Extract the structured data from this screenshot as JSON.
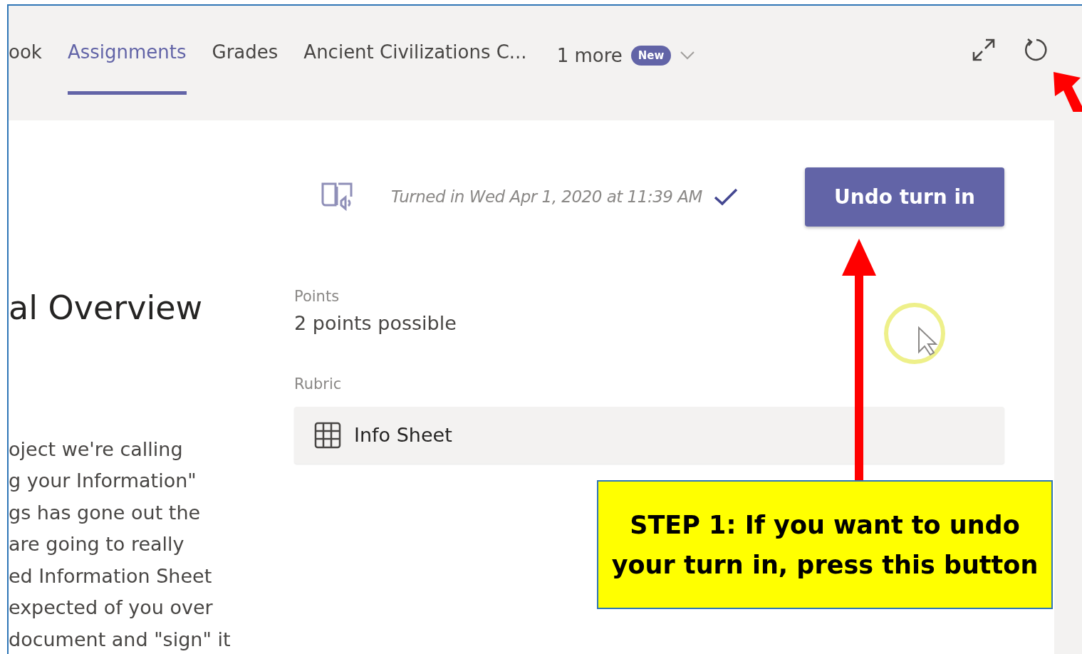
{
  "tabs": [
    {
      "label": "ook",
      "selected": false
    },
    {
      "label": "Assignments",
      "selected": true
    },
    {
      "label": "Grades",
      "selected": false
    },
    {
      "label": "Ancient Civilizations C...",
      "selected": false
    }
  ],
  "more_tab": {
    "label": "1 more",
    "badge": "New"
  },
  "assignment": {
    "title": "al Overview",
    "description": [
      "oject we're calling",
      "g your Information\"",
      "gs has gone out the",
      "are going to really",
      "ed Information Sheet",
      "expected of you over",
      "document and \"sign\" it"
    ],
    "status": "Turned in Wed Apr 1, 2020 at 11:39 AM",
    "turned_in": true,
    "action_button": "Undo turn in",
    "points_label": "Points",
    "points": "2 points possible",
    "rubric_label": "Rubric",
    "rubric": "Info Sheet"
  },
  "callout": {
    "text": "STEP 1: If you want to undo your turn in, press this button"
  }
}
